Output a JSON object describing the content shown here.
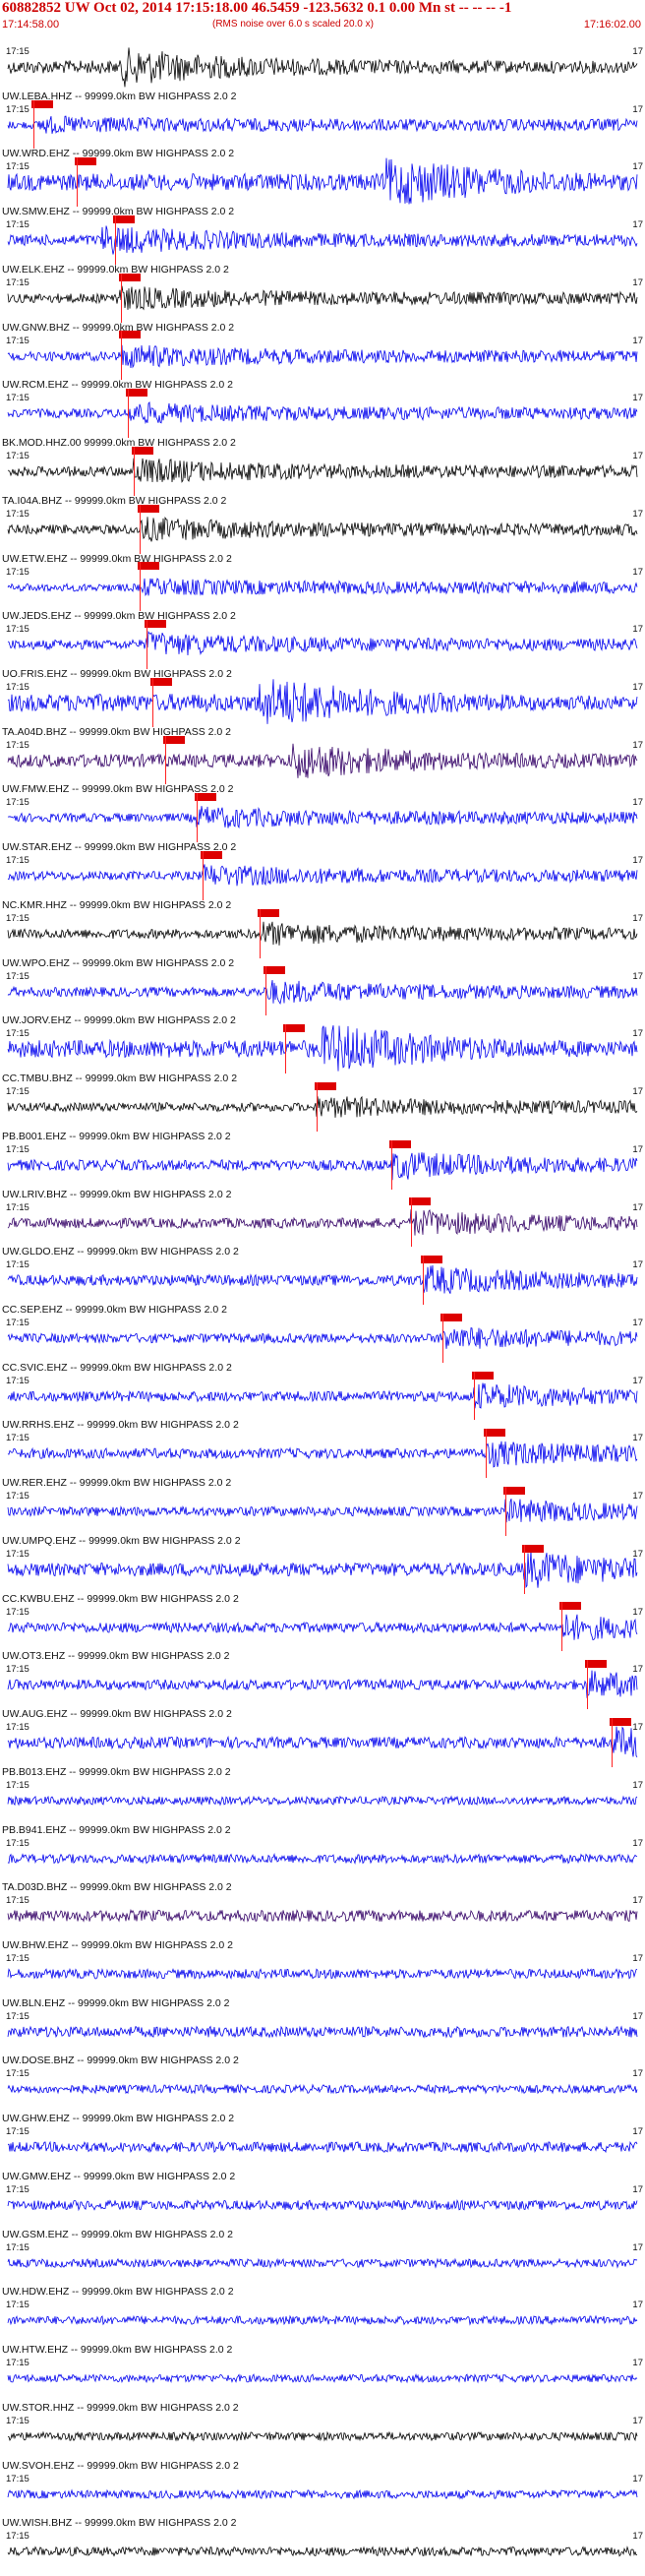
{
  "header": {
    "title": "60882852 UW Oct 02, 2014 17:15:18.00   46.5459 -123.5632  0.1 0.00 Mn st -- -- --  -1",
    "time_start": "17:14:58.00",
    "time_end": "17:16:02.00",
    "rms_note": "(RMS noise over 6.0 s scaled 20.0 x)"
  },
  "colors": {
    "red": "#dd0000",
    "blue": "#0000ee",
    "black": "#000000",
    "purple": "#330066"
  },
  "chart_data": {
    "type": "line",
    "title": "60882852 UW Oct 02, 2014 17:15:18.00   46.5459 -123.5632  0.1 0.00 Mn st -- -- --  -1",
    "x_range": [
      "17:14:58.00",
      "17:16:02.00"
    ],
    "tick_labels": [
      "17:15",
      "17"
    ],
    "series": [
      {
        "name": "",
        "color": "black",
        "amp": 0.6,
        "burst": 0.18,
        "pick": null
      },
      {
        "name": "UW.LEBA.HHZ -- 99999.0km BW  HIGHPASS  2.0  2",
        "color": "blue",
        "amp": 0.15,
        "burst": 0.05,
        "pick": 0.04
      },
      {
        "name": "UW.WRD.EHZ -- 99999.0km BW  HIGHPASS  2.0  2",
        "color": "blue",
        "amp": 0.9,
        "burst": 0.6,
        "pick": 0.11
      },
      {
        "name": "UW.SMW.EHZ -- 99999.0km BW  HIGHPASS  2.0  2",
        "color": "blue",
        "amp": 0.4,
        "burst": 0.15,
        "pick": 0.17
      },
      {
        "name": "UW.ELK.EHZ -- 99999.0km BW  HIGHPASS  2.0  2",
        "color": "black",
        "amp": 0.3,
        "burst": 0.17,
        "pick": 0.18
      },
      {
        "name": "UW.GNW.BHZ -- 99999.0km BW  HIGHPASS  2.0  2",
        "color": "blue",
        "amp": 0.3,
        "burst": 0.18,
        "pick": 0.18
      },
      {
        "name": "UW.RCM.EHZ -- 99999.0km BW  HIGHPASS  2.0  2",
        "color": "blue",
        "amp": 0.25,
        "burst": 0.19,
        "pick": 0.19
      },
      {
        "name": "BK.MOD.HHZ.00  99999.0km BW  HIGHPASS  2.0  2",
        "color": "black",
        "amp": 0.35,
        "burst": 0.2,
        "pick": 0.2
      },
      {
        "name": "TA.I04A.BHZ -- 99999.0km BW  HIGHPASS  2.0  2",
        "color": "black",
        "amp": 0.3,
        "burst": 0.21,
        "pick": 0.21
      },
      {
        "name": "UW.ETW.EHZ -- 99999.0km BW  HIGHPASS  2.0  2",
        "color": "blue",
        "amp": 0.15,
        "burst": 0.21,
        "pick": 0.21
      },
      {
        "name": "UW.JEDS.EHZ -- 99999.0km BW  HIGHPASS  2.0  2",
        "color": "blue",
        "amp": 0.3,
        "burst": 0.22,
        "pick": 0.22
      },
      {
        "name": "UO.FRIS.EHZ -- 99999.0km BW  HIGHPASS  2.0  2",
        "color": "blue",
        "amp": 0.95,
        "burst": 0.4,
        "pick": 0.23
      },
      {
        "name": "TA.A04D.BHZ -- 99999.0km BW  HIGHPASS  2.0  2",
        "color": "purple",
        "amp": 0.6,
        "burst": 0.45,
        "pick": 0.25
      },
      {
        "name": "UW.FMW.EHZ -- 99999.0km BW  HIGHPASS  2.0  2",
        "color": "blue",
        "amp": 0.25,
        "burst": 0.3,
        "pick": 0.3
      },
      {
        "name": "UW.STAR.EHZ -- 99999.0km BW  HIGHPASS  2.0  2",
        "color": "blue",
        "amp": 0.25,
        "burst": 0.31,
        "pick": 0.31
      },
      {
        "name": "NC.KMR.HHZ -- 99999.0km BW  HIGHPASS  2.0  2",
        "color": "black",
        "amp": 0.3,
        "burst": 0.4,
        "pick": 0.4
      },
      {
        "name": "UW.WPO.EHZ -- 99999.0km BW  HIGHPASS  2.0  2",
        "color": "blue",
        "amp": 0.3,
        "burst": 0.41,
        "pick": 0.41
      },
      {
        "name": "UW.JORV.EHZ -- 99999.0km BW  HIGHPASS  2.0  2",
        "color": "blue",
        "amp": 0.95,
        "burst": 0.5,
        "pick": 0.44
      },
      {
        "name": "CC.TMBU.BHZ -- 99999.0km BW  HIGHPASS  2.0  2",
        "color": "black",
        "amp": 0.25,
        "burst": 0.49,
        "pick": 0.49
      },
      {
        "name": "PB.B001.EHZ -- 99999.0km BW  HIGHPASS  2.0  2",
        "color": "blue",
        "amp": 0.4,
        "burst": 0.61,
        "pick": 0.61
      },
      {
        "name": "UW.LRIV.BHZ -- 99999.0km BW  HIGHPASS  2.0  2",
        "color": "purple",
        "amp": 0.35,
        "burst": 0.64,
        "pick": 0.64
      },
      {
        "name": "UW.GLDO.EHZ -- 99999.0km BW  HIGHPASS  2.0  2",
        "color": "blue",
        "amp": 0.4,
        "burst": 0.66,
        "pick": 0.66
      },
      {
        "name": "CC.SEP.EHZ -- 99999.0km BW  HIGHPASS  2.0  2",
        "color": "blue",
        "amp": 0.3,
        "burst": 0.69,
        "pick": 0.69
      },
      {
        "name": "CC.SVIC.EHZ -- 99999.0km BW  HIGHPASS  2.0  2",
        "color": "blue",
        "amp": 0.35,
        "burst": 0.74,
        "pick": 0.74
      },
      {
        "name": "UW.RRHS.EHZ -- 99999.0km BW  HIGHPASS  2.0  2",
        "color": "blue",
        "amp": 0.35,
        "burst": 0.76,
        "pick": 0.76
      },
      {
        "name": "UW.RER.EHZ -- 99999.0km BW  HIGHPASS  2.0  2",
        "color": "blue",
        "amp": 0.3,
        "burst": 0.79,
        "pick": 0.79
      },
      {
        "name": "UW.UMPQ.EHZ -- 99999.0km BW  HIGHPASS  2.0  2",
        "color": "blue",
        "amp": 0.6,
        "burst": 0.82,
        "pick": 0.82
      },
      {
        "name": "CC.KWBU.EHZ -- 99999.0km BW  HIGHPASS  2.0  2",
        "color": "blue",
        "amp": 0.35,
        "burst": 0.88,
        "pick": 0.88
      },
      {
        "name": "UW.OT3.EHZ -- 99999.0km BW  HIGHPASS  2.0  2",
        "color": "blue",
        "amp": 0.35,
        "burst": 0.92,
        "pick": 0.92
      },
      {
        "name": "UW.AUG.EHZ -- 99999.0km BW  HIGHPASS  2.0  2",
        "color": "blue",
        "amp": 0.45,
        "burst": 0.96,
        "pick": 0.96
      },
      {
        "name": "PB.B013.EHZ -- 99999.0km BW  HIGHPASS  2.0  2",
        "color": "blue",
        "amp": 0.2,
        "burst": null,
        "pick": null
      },
      {
        "name": "PB.B941.EHZ -- 99999.0km BW  HIGHPASS  2.0  2",
        "color": "blue",
        "amp": 0.25,
        "burst": null,
        "pick": null
      },
      {
        "name": "TA.D03D.BHZ -- 99999.0km BW  HIGHPASS  2.0  2",
        "color": "purple",
        "amp": 0.45,
        "burst": null,
        "pick": null
      },
      {
        "name": "UW.BHW.EHZ -- 99999.0km BW  HIGHPASS  2.0  2",
        "color": "blue",
        "amp": 0.3,
        "burst": null,
        "pick": null
      },
      {
        "name": "UW.BLN.EHZ -- 99999.0km BW  HIGHPASS  2.0  2",
        "color": "blue",
        "amp": 0.4,
        "burst": null,
        "pick": null
      },
      {
        "name": "UW.DOSE.BHZ -- 99999.0km BW  HIGHPASS  2.0  2",
        "color": "blue",
        "amp": 0.2,
        "burst": null,
        "pick": null
      },
      {
        "name": "UW.GHW.EHZ -- 99999.0km BW  HIGHPASS  2.0  2",
        "color": "blue",
        "amp": 0.35,
        "burst": null,
        "pick": null
      },
      {
        "name": "UW.GMW.EHZ -- 99999.0km BW  HIGHPASS  2.0  2",
        "color": "blue",
        "amp": 0.3,
        "burst": null,
        "pick": null
      },
      {
        "name": "UW.GSM.EHZ -- 99999.0km BW  HIGHPASS  2.0  2",
        "color": "blue",
        "amp": 0.2,
        "burst": null,
        "pick": null
      },
      {
        "name": "UW.HDW.EHZ -- 99999.0km BW  HIGHPASS  2.0  2",
        "color": "blue",
        "amp": 0.2,
        "burst": null,
        "pick": null
      },
      {
        "name": "UW.HTW.EHZ -- 99999.0km BW  HIGHPASS  2.0  2",
        "color": "blue",
        "amp": 0.15,
        "burst": null,
        "pick": null
      },
      {
        "name": "UW.STOR.HHZ -- 99999.0km BW  HIGHPASS  2.0  2",
        "color": "black",
        "amp": 0.2,
        "burst": null,
        "pick": null
      },
      {
        "name": "UW.SVOH.EHZ -- 99999.0km BW  HIGHPASS  2.0  2",
        "color": "blue",
        "amp": 0.2,
        "burst": null,
        "pick": null
      },
      {
        "name": "UW.WISH.BHZ -- 99999.0km BW  HIGHPASS  2.0  2",
        "color": "black",
        "amp": 0.25,
        "burst": null,
        "pick": null
      }
    ]
  }
}
